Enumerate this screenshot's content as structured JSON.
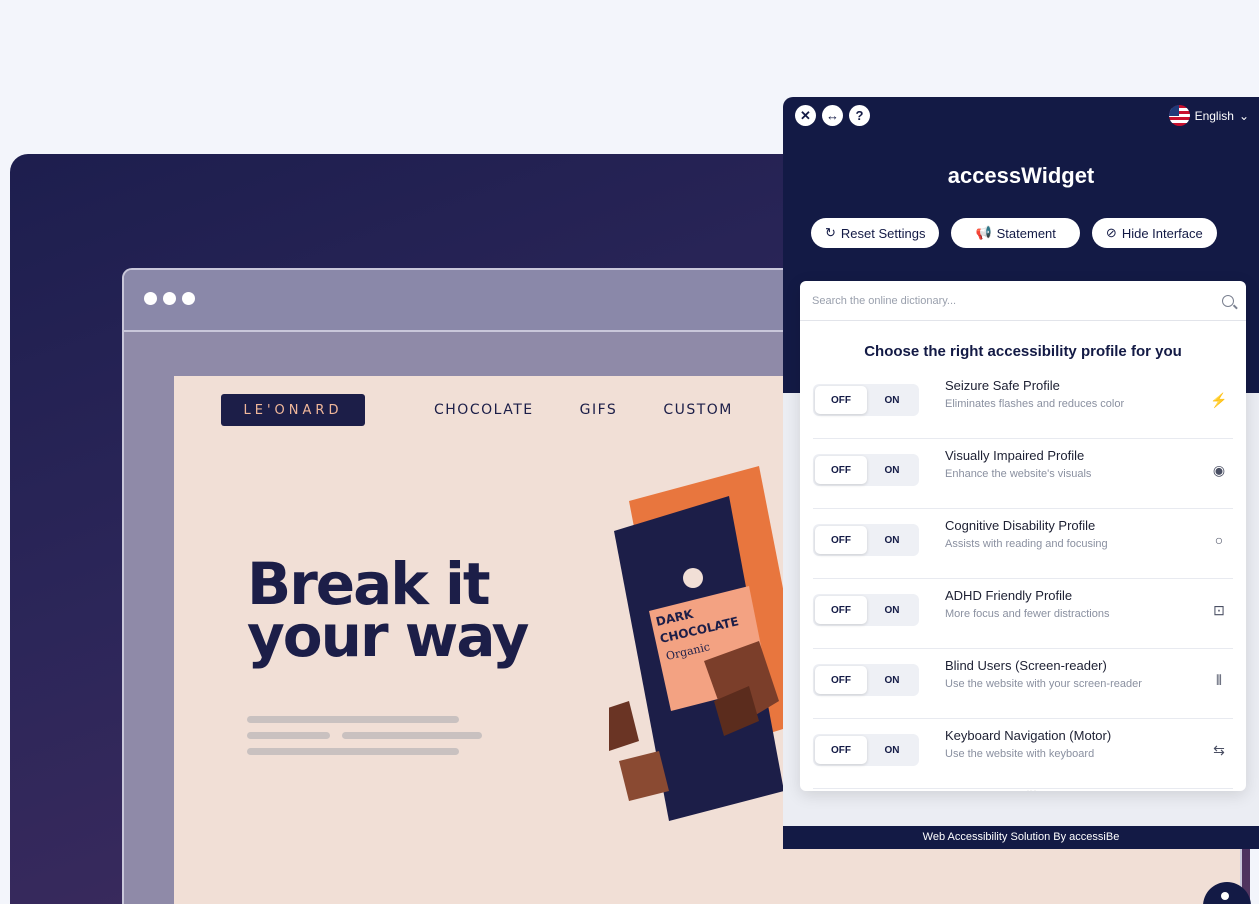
{
  "website": {
    "logo": "LE'ONARD",
    "nav": [
      "CHOCOLATE",
      "GIFS",
      "CUSTOM"
    ],
    "hero_line1": "Break it",
    "hero_line2": "your way",
    "product_line1": "DARK",
    "product_line2": "CHOCOLATE",
    "product_line3": "Organic"
  },
  "widget": {
    "language": "English",
    "title": "accessWidget",
    "buttons": {
      "reset": "Reset Settings",
      "statement": "Statement",
      "hide": "Hide Interface"
    },
    "search": {
      "placeholder": "Search the online dictionary..."
    },
    "profiles_heading": "Choose the right accessibility profile for you",
    "toggle": {
      "off": "OFF",
      "on": "ON"
    },
    "profiles": [
      {
        "name": "Seizure Safe Profile",
        "description": "Eliminates flashes and reduces color",
        "icon": "flash-off-icon"
      },
      {
        "name": "Visually Impaired Profile",
        "description": "Enhance the website's visuals",
        "icon": "eye-icon"
      },
      {
        "name": "Cognitive Disability Profile",
        "description": "Assists with reading and focusing",
        "icon": "circle-icon"
      },
      {
        "name": "ADHD Friendly Profile",
        "description": "More focus and fewer distractions",
        "icon": "focus-icon"
      },
      {
        "name": "Blind Users (Screen-reader)",
        "description": "Use the website with your screen-reader",
        "icon": "audio-icon"
      },
      {
        "name": "Keyboard Navigation (Motor)",
        "description": "Use the website with keyboard",
        "icon": "arrows-icon"
      }
    ],
    "footer": "Web Accessibility Solution By accessiBe"
  },
  "colors": {
    "widget_navy": "#131a45",
    "site_bg": "#f1dfd6",
    "accent_orange": "#e8763e"
  }
}
